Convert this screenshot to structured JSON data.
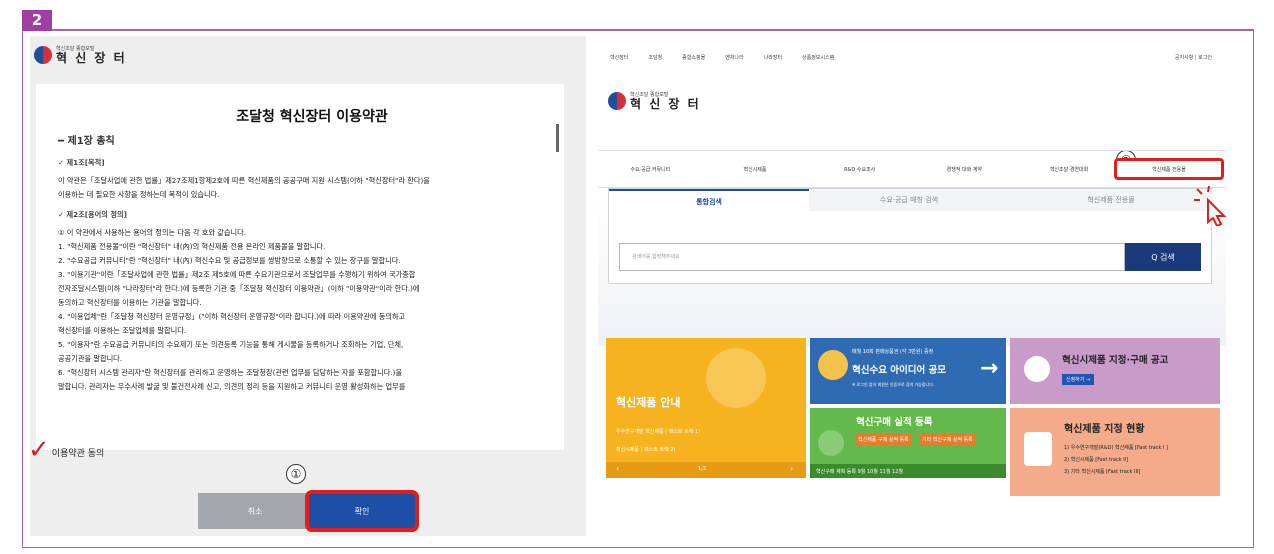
{
  "badge": "2",
  "left": {
    "logo": {
      "small": "혁신조달 종합포털",
      "big": "혁 신 장 터"
    },
    "title": "조달청 혁신장터 이용약관",
    "chapter": "━ 제1장 총칙",
    "paragraphs": [
      {
        "text": "✓ 제1조[목적]",
        "h": true
      },
      {
        "text": "이 약관은「조달사업에 관한 법률」제27조제1항제2호에 따른 혁신제품의 공공구매 지원 시스템(이하 \"혁신장터\"라 한다)을"
      },
      {
        "text": "이용하는 데 필요한 사항을 정하는데 목적이 있습니다."
      },
      {
        "text": "✓ 제2조[용어의 정의]",
        "h": true
      },
      {
        "text": "① 이 약관에서 사용하는 용어의 정의는 다음 각 호와 같습니다."
      },
      {
        "text": "1. \"혁신제품 전용몰\"이란 \"혁신장터\" 내(內)의 혁신제품 전용 온라인 제품몰을 말합니다."
      },
      {
        "text": "2. \"수요공급 커뮤니티\"란 \"혁신장터\" 내(內) 혁신수요 및 공급정보를 쌍방향으로 소통할 수 있는 창구를 말합니다."
      },
      {
        "text": "3. \"이용기관\"이란「조달사업에 관한 법률」제2조 제5호에 따른 수요기관으로서 조달업무를 수행하기 위하여 국가종합"
      },
      {
        "text": "전자조달시스템(이하 \"나라장터\"라 한다.)에 등록한 기관 중「조달청 혁신장터 이용약관」(이하 \"이용약관\"이라 한다.)에"
      },
      {
        "text": "동의하고 혁신장터를 이용하는 기관을 말합니다."
      },
      {
        "text": "4. \"이용업체\"란「조달청 혁신장터 운영규정」(\"이하 혁신장터 운영규정\"이라 합니다.)에 따라 이용약관에 동의하고"
      },
      {
        "text": "혁신장터를 이용하는 조달업체를 말합니다."
      },
      {
        "text": "5. \"이용자\"란 수요공급 커뮤니티의 수요제기 또는 의견등록 기능을 통해 게시물을 등록하거나 조회하는 기업, 단체,"
      },
      {
        "text": "공공기관을 말합니다."
      },
      {
        "text": "6. \"혁신장터 시스템 관리자\"란 혁신장터를 관리하고 운영하는 조달청장(관련 업무를 담당하는 자를 포함합니다.)을"
      },
      {
        "text": "말합니다. 관리자는 우수사례 발굴 및 불건전사례 신고, 의견의 정리 등을 지원하고 커뮤니티 운영 활성화하는 업무를"
      }
    ],
    "agree_label": "이용약관 동의",
    "cancel_label": "취소",
    "ok_label": "확인",
    "marker1": "①"
  },
  "right": {
    "gnb": [
      "혁신장터",
      "조달청",
      "종합쇼핑몰",
      "벤처나라",
      "나라장터",
      "상품정보시스템"
    ],
    "gnb_right": "공지사항 | 로그인",
    "logo": {
      "small": "혁신조달 종합포털",
      "big": "혁 신 장 터"
    },
    "tabs": [
      "수요·공급 커뮤니티",
      "혁신시제품",
      "R&D 수요조사",
      "경쟁적 대화 계약",
      "혁신조달 경연대회"
    ],
    "tab_highlight": "혁신제품 전용몰",
    "marker2": "②",
    "search_tabs": [
      "통합검색",
      "수요·공급 매칭 검색",
      "혁신제품 전용몰"
    ],
    "search_placeholder": "검색어를 입력해주세요",
    "search_button": "Q 검색",
    "cards": {
      "c1_title": "혁신제품 안내",
      "c1_item1": "우수연구개발 혁신제품 ( 패스트 트랙 1)",
      "c1_item2": "혁신시제품 ( 패스트 트랙 2)",
      "c1_page": "1/2",
      "c2_small": "매월 10회 판매상품권 (각 3만원) 증정",
      "c2_title": "혁신수요 아이디어 공모",
      "c2_sub": "※ 로그인 없이 회원은 인증으로 참여 가능합니다.",
      "c3_title": "혁신구매 실적 등록",
      "c3_item1": "혁신제품 구매 실적 등록",
      "c3_item2": "기타 혁신구매 실적 등록",
      "c3_months": "혁신구매 계획 등록  9월 10월 11월 12월",
      "c4_title": "혁신시제품 지정·구매 공고",
      "c4_pill": "신청하기 →",
      "c5_title": "혁신제품 지정 현황",
      "c5_l1": "1) 우수연구개발(R&D) 혁신제품 [Fast track I ]",
      "c5_l2": "2) 혁신시제품 [Fast track II]",
      "c5_l3": "3) 기타 혁신시제품 [Fast track III]"
    }
  },
  "colors": {
    "accent": "#a13ea1",
    "highlight": "#e61b1b",
    "primary": "#1d4fa6"
  }
}
